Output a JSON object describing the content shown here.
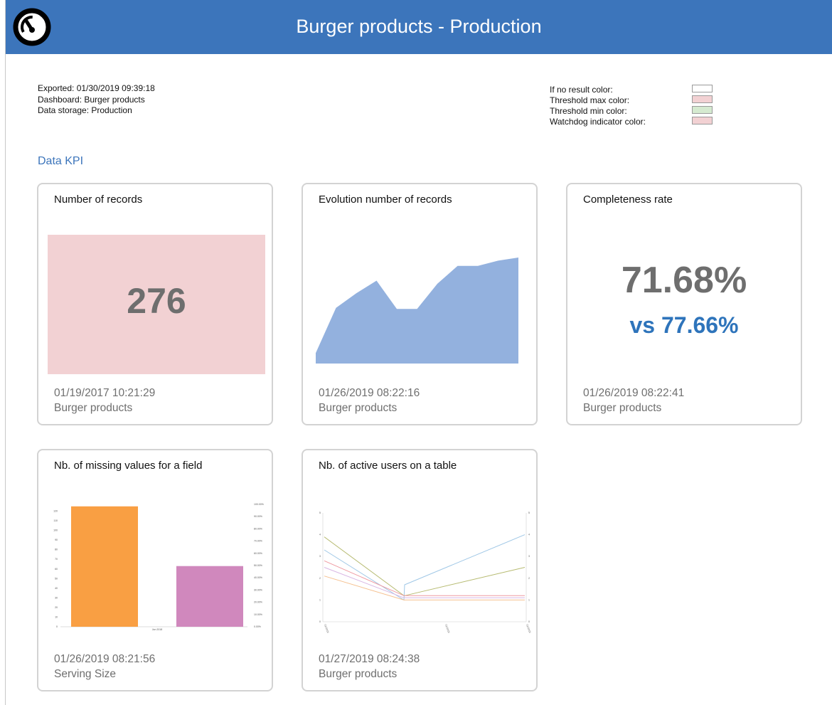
{
  "header": {
    "title": "Burger products - Production",
    "logo_icon": "gauge-icon"
  },
  "meta": {
    "exported": "Exported: 01/30/2019 09:39:18",
    "dashboard": "Dashboard: Burger products",
    "storage": "Data storage: Production"
  },
  "legend": [
    {
      "label": "If no result color:",
      "color": "#ffffff"
    },
    {
      "label": "Threshold max color:",
      "color": "#f2d1d3"
    },
    {
      "label": "Threshold min color:",
      "color": "#d5ead0"
    },
    {
      "label": "Watchdog indicator color:",
      "color": "#f2d1d3"
    }
  ],
  "section_title": "Data KPI",
  "cards": [
    {
      "title": "Number of records",
      "value": "276",
      "bg_color": "#f2d1d3",
      "date": "01/19/2017 10:21:29",
      "source": "Burger products"
    },
    {
      "title": "Evolution number of records",
      "date": "01/26/2019 08:22:16",
      "source": "Burger products"
    },
    {
      "title": "Completeness rate",
      "value": "71.68%",
      "compare": "vs 77.66%",
      "date": "01/26/2019 08:22:41",
      "source": "Burger products"
    },
    {
      "title": "Nb. of missing values for a field",
      "date": "01/26/2019 08:21:56",
      "source": "Serving Size"
    },
    {
      "title": "Nb. of active users on a table",
      "date": "01/27/2019 08:24:38",
      "source": "Burger products"
    }
  ],
  "chart_data": [
    {
      "type": "area",
      "color": "#93b1de",
      "values": [
        1,
        5.3,
        6.7,
        7.9,
        5.2,
        5.2,
        7.6,
        9.3,
        9.3,
        9.8,
        10.1
      ],
      "ylim": [
        0,
        12
      ]
    },
    {
      "type": "bar",
      "categories": [
        "Jun 2018"
      ],
      "series": [
        {
          "values": [
            125
          ],
          "color": "#f99f43"
        },
        {
          "values": [
            63
          ],
          "color": "#d088bd"
        }
      ],
      "ylim": [
        0,
        130
      ],
      "yticks": [
        0,
        10,
        20,
        30,
        40,
        50,
        60,
        70,
        80,
        90,
        100,
        110,
        120
      ],
      "y2ticks": [
        "0.00%",
        "10.00%",
        "20.00%",
        "30.00%",
        "40.00%",
        "50.00%",
        "60.00%",
        "70.00%",
        "80.00%",
        "90.00%",
        "100.00%"
      ]
    },
    {
      "type": "line",
      "ylim": [
        0,
        5
      ],
      "yticks": [
        0,
        1,
        2,
        3,
        4,
        5
      ],
      "x_labels": [
        "01/2019",
        "01/2019",
        "01/2019"
      ],
      "series": [
        {
          "color": "#9fc7e6",
          "values": [
            3.3,
            1,
            1.7,
            4
          ]
        },
        {
          "color": "#b7bb72",
          "values": [
            3.9,
            1.2,
            1.2,
            2.5
          ]
        },
        {
          "color": "#ef9aa1",
          "values": [
            2.8,
            1.2,
            1.2,
            1.2
          ]
        },
        {
          "color": "#d8b5e3",
          "values": [
            2.5,
            1.1,
            1.1,
            1.1
          ]
        },
        {
          "color": "#f5c08f",
          "values": [
            2.1,
            1,
            1,
            1
          ]
        }
      ]
    }
  ]
}
